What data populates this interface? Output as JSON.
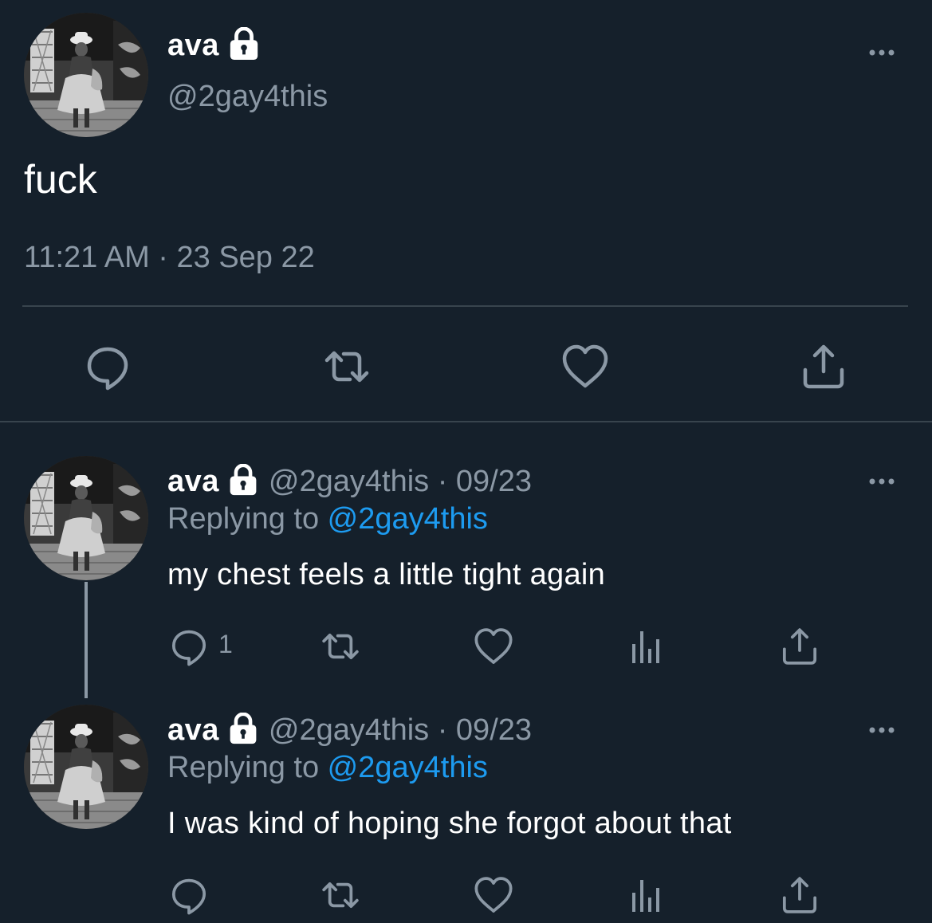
{
  "main_tweet": {
    "display_name": "ava",
    "handle": "@2gay4this",
    "text": "fuck",
    "timestamp": "11:21 AM · 23 Sep 22",
    "icons": [
      "lock-icon",
      "more-icon",
      "reply-icon",
      "retweet-icon",
      "like-icon",
      "share-icon"
    ]
  },
  "replies": [
    {
      "display_name": "ava",
      "meta": "@2gay4this · 09/23",
      "replying_prefix": "Replying to ",
      "replying_handle": "@2gay4this",
      "text": "my chest feels a little tight again",
      "reply_count": "1",
      "icons": [
        "reply-icon",
        "retweet-icon",
        "like-icon",
        "analytics-icon",
        "share-icon"
      ]
    },
    {
      "display_name": "ava",
      "meta": "@2gay4this · 09/23",
      "replying_prefix": "Replying to ",
      "replying_handle": "@2gay4this",
      "text": "I was kind of hoping she forgot about that",
      "reply_count": "",
      "icons": [
        "reply-icon",
        "retweet-icon",
        "like-icon",
        "analytics-icon",
        "share-icon"
      ]
    }
  ],
  "colors": {
    "background": "#15202b",
    "secondary_text": "#8b98a5",
    "link": "#1d9bf0",
    "divider": "#38444d"
  }
}
